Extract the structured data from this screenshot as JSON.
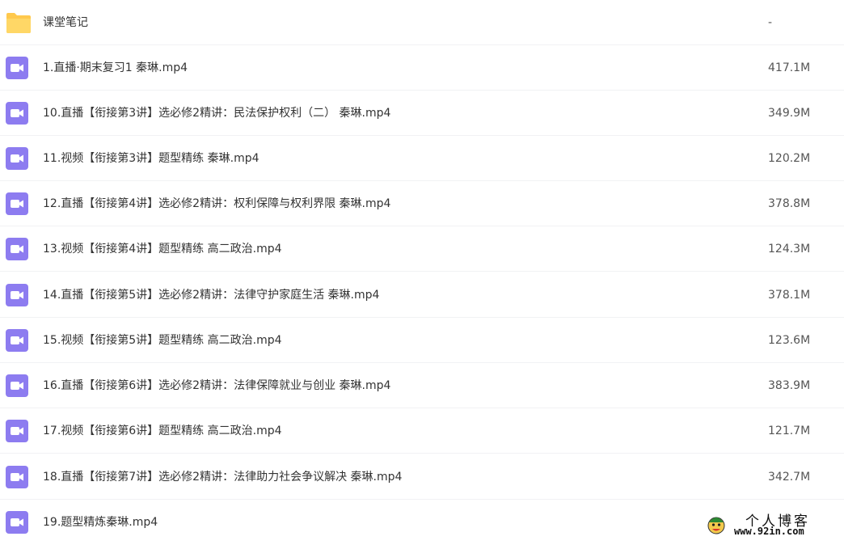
{
  "files": [
    {
      "name": "课堂笔记",
      "size": "-",
      "type": "folder"
    },
    {
      "name": "1.直播·期末复习1 秦琳.mp4",
      "size": "417.1M",
      "type": "video"
    },
    {
      "name": "10.直播【衔接第3讲】选必修2精讲：民法保护权利（二） 秦琳.mp4",
      "size": "349.9M",
      "type": "video"
    },
    {
      "name": "11.视频【衔接第3讲】题型精练 秦琳.mp4",
      "size": "120.2M",
      "type": "video"
    },
    {
      "name": "12.直播【衔接第4讲】选必修2精讲：权利保障与权利界限 秦琳.mp4",
      "size": "378.8M",
      "type": "video"
    },
    {
      "name": "13.视频【衔接第4讲】题型精练 高二政治.mp4",
      "size": "124.3M",
      "type": "video"
    },
    {
      "name": "14.直播【衔接第5讲】选必修2精讲：法律守护家庭生活 秦琳.mp4",
      "size": "378.1M",
      "type": "video"
    },
    {
      "name": "15.视频【衔接第5讲】题型精练 高二政治.mp4",
      "size": "123.6M",
      "type": "video"
    },
    {
      "name": "16.直播【衔接第6讲】选必修2精讲：法律保障就业与创业 秦琳.mp4",
      "size": "383.9M",
      "type": "video"
    },
    {
      "name": "17.视频【衔接第6讲】题型精练 高二政治.mp4",
      "size": "121.7M",
      "type": "video"
    },
    {
      "name": "18.直播【衔接第7讲】选必修2精讲：法律助力社会争议解决 秦琳.mp4",
      "size": "342.7M",
      "type": "video"
    },
    {
      "name": "19.题型精炼秦琳.mp4",
      "size": "",
      "type": "video"
    }
  ],
  "watermark": {
    "title": "个人博客",
    "url": "www.92in.com"
  },
  "icons": {
    "folder": "folder-icon",
    "video": "video-file-icon"
  },
  "colors": {
    "folder": "#ffc94d",
    "video": "#8d7cf0",
    "divider": "#f1f2f4"
  }
}
